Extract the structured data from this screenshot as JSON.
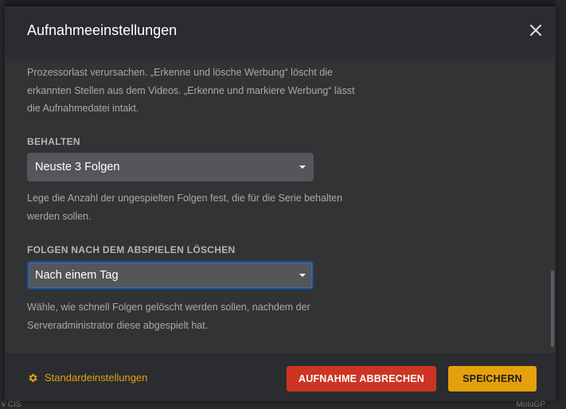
{
  "dialog": {
    "title": "Aufnahmeeinstellungen",
    "close_icon": "close-icon"
  },
  "content": {
    "intro_help": [
      "Prozessorlast verursachen. „Erkenne und lösche Werbung“ löscht die",
      "erkannten Stellen aus dem Videos. „Erkenne und markiere Werbung“ lässt",
      "die Aufnahmedatei intakt."
    ],
    "keep": {
      "label": "BEHALTEN",
      "value": "Neuste 3 Folgen",
      "help": [
        "Lege die Anzahl der ungespielten Folgen fest, die für die Serie behalten",
        "werden sollen."
      ]
    },
    "delete_after": {
      "label": "FOLGEN NACH DEM ABSPIELEN LÖSCHEN",
      "value": "Nach einem Tag",
      "help": [
        "Wähle, wie schnell Folgen gelöscht werden sollen, nachdem der",
        "Serveradministrator diese abgespielt hat."
      ]
    }
  },
  "footer": {
    "defaults_label": "Standardeinstellungen",
    "defaults_icon": "gear-icon",
    "cancel_label": "AUFNAHME ABBRECHEN",
    "save_label": "SPEICHERN"
  },
  "background": {
    "bottom_right_text": "MotoGP",
    "bottom_left_text": "v CIS"
  },
  "colors": {
    "accent": "#e5a00d",
    "danger": "#cc3524",
    "dialog_bg": "#323335",
    "header_bg": "#2b2c2f",
    "select_bg": "#55565a",
    "focus_border": "#204f8e"
  }
}
